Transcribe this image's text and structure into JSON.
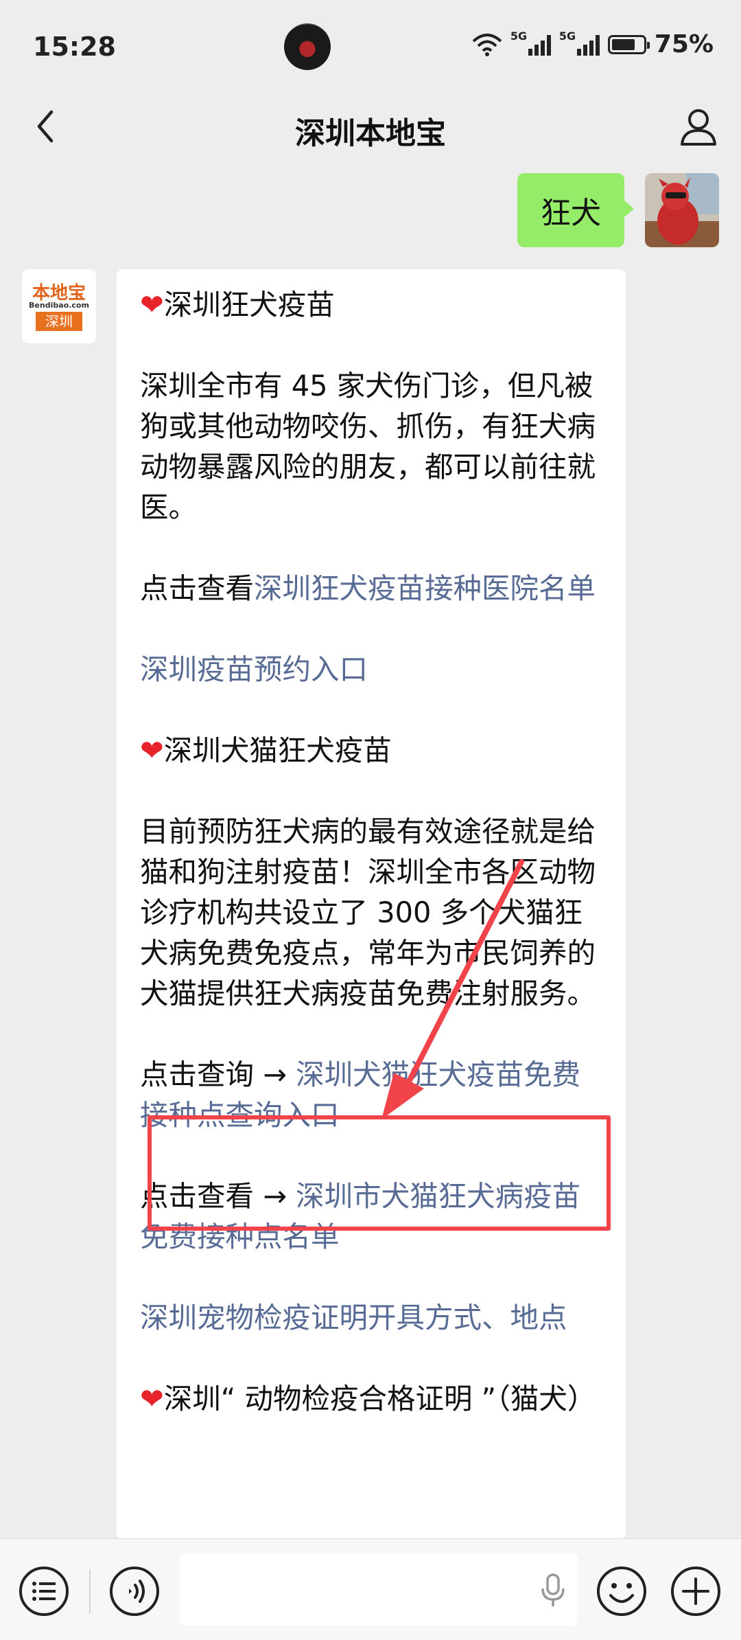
{
  "status_bar": {
    "time": "15:28",
    "signal_1": "5G",
    "signal_2": "5G",
    "battery_percent": "75%",
    "battery_level": 0.75
  },
  "header": {
    "title": "深圳本地宝"
  },
  "chat": {
    "sent": {
      "text": "狂犬"
    },
    "bot_avatar": {
      "line1": "本地宝",
      "line2": "Bendibao.com",
      "line3": "深圳"
    },
    "received": {
      "heading1": "深圳狂犬疫苗",
      "para1": "深圳全市有 45 家犬伤门诊，但凡被狗或其他动物咬伤、抓伤，有狂犬病动物暴露风险的朋友，都可以前往就医。",
      "para2_prefix": "点击查看",
      "para2_link": "深圳狂犬疫苗接种医院名单",
      "link3": "深圳疫苗预约入口",
      "heading2": "深圳犬猫狂犬疫苗",
      "para4": "目前预防狂犬病的最有效途径就是给猫和狗注射疫苗！深圳全市各区动物诊疗机构共设立了 300 多个犬猫狂犬病免费免疫点，常年为市民饲养的犬猫提供狂犬病疫苗免费注射服务。",
      "para5_prefix": "点击查询 → ",
      "para5_link": "深圳犬猫狂犬疫苗免费接种点查询入口",
      "para6_prefix": "点击查看 → ",
      "para6_link": "深圳市犬猫狂犬病疫苗免费接种点名单",
      "link7": "深圳宠物检疫证明开具方式、地点",
      "heading3": "深圳“ 动物检疫合格证明 ”（猫犬）"
    }
  },
  "colors": {
    "link": "#576b95",
    "sent_bubble": "#95ec69",
    "highlight": "#f0434a",
    "heart": "#e8232b"
  }
}
